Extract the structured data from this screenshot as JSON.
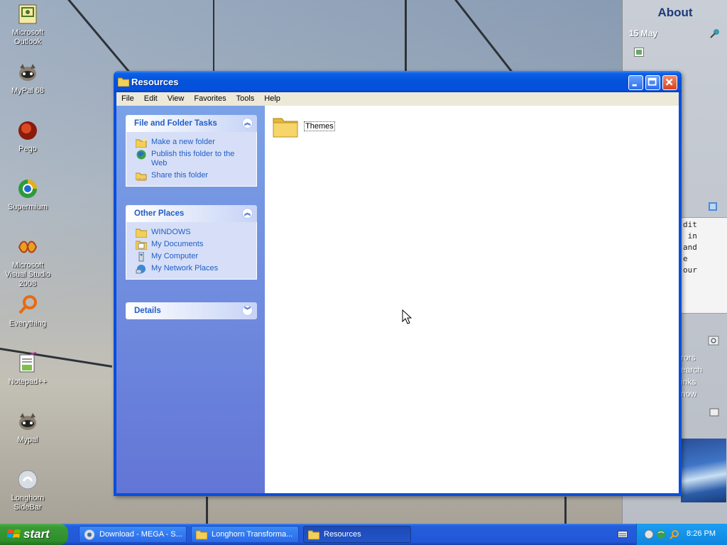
{
  "desktop": {
    "icons": [
      {
        "label": "Microsoft Outlook"
      },
      {
        "label": "MyPal 68"
      },
      {
        "label": "Pego"
      },
      {
        "label": "Supermium"
      },
      {
        "label": "Microsoft Visual Studio 2008"
      },
      {
        "label": "Everything"
      },
      {
        "label": "Notepad++"
      },
      {
        "label": "Mypal"
      },
      {
        "label": "Longhorn SideBar"
      }
    ]
  },
  "sidebar": {
    "title": "About",
    "date": "15 May",
    "notes": "dit\n in\nand\ne\nour",
    "links": [
      "rors",
      "earch",
      "inks",
      "now"
    ]
  },
  "window": {
    "title": "Resources",
    "menu": [
      "File",
      "Edit",
      "View",
      "Favorites",
      "Tools",
      "Help"
    ],
    "tasks_header": "File and Folder Tasks",
    "tasks": [
      "Make a new folder",
      "Publish this folder to the Web",
      "Share this folder"
    ],
    "places_header": "Other Places",
    "places": [
      "WINDOWS",
      "My Documents",
      "My Computer",
      "My Network Places"
    ],
    "details_header": "Details",
    "folder": {
      "name": "Themes"
    }
  },
  "taskbar": {
    "start": "start",
    "tasks": [
      {
        "label": "Download - MEGA - S..."
      },
      {
        "label": "Longhorn Transforma..."
      },
      {
        "label": "Resources"
      }
    ],
    "clock": "8:26 PM"
  },
  "colors": {
    "title_blue": "#0352d8",
    "start_green": "#3a9b36",
    "task_link": "#215dc6"
  }
}
